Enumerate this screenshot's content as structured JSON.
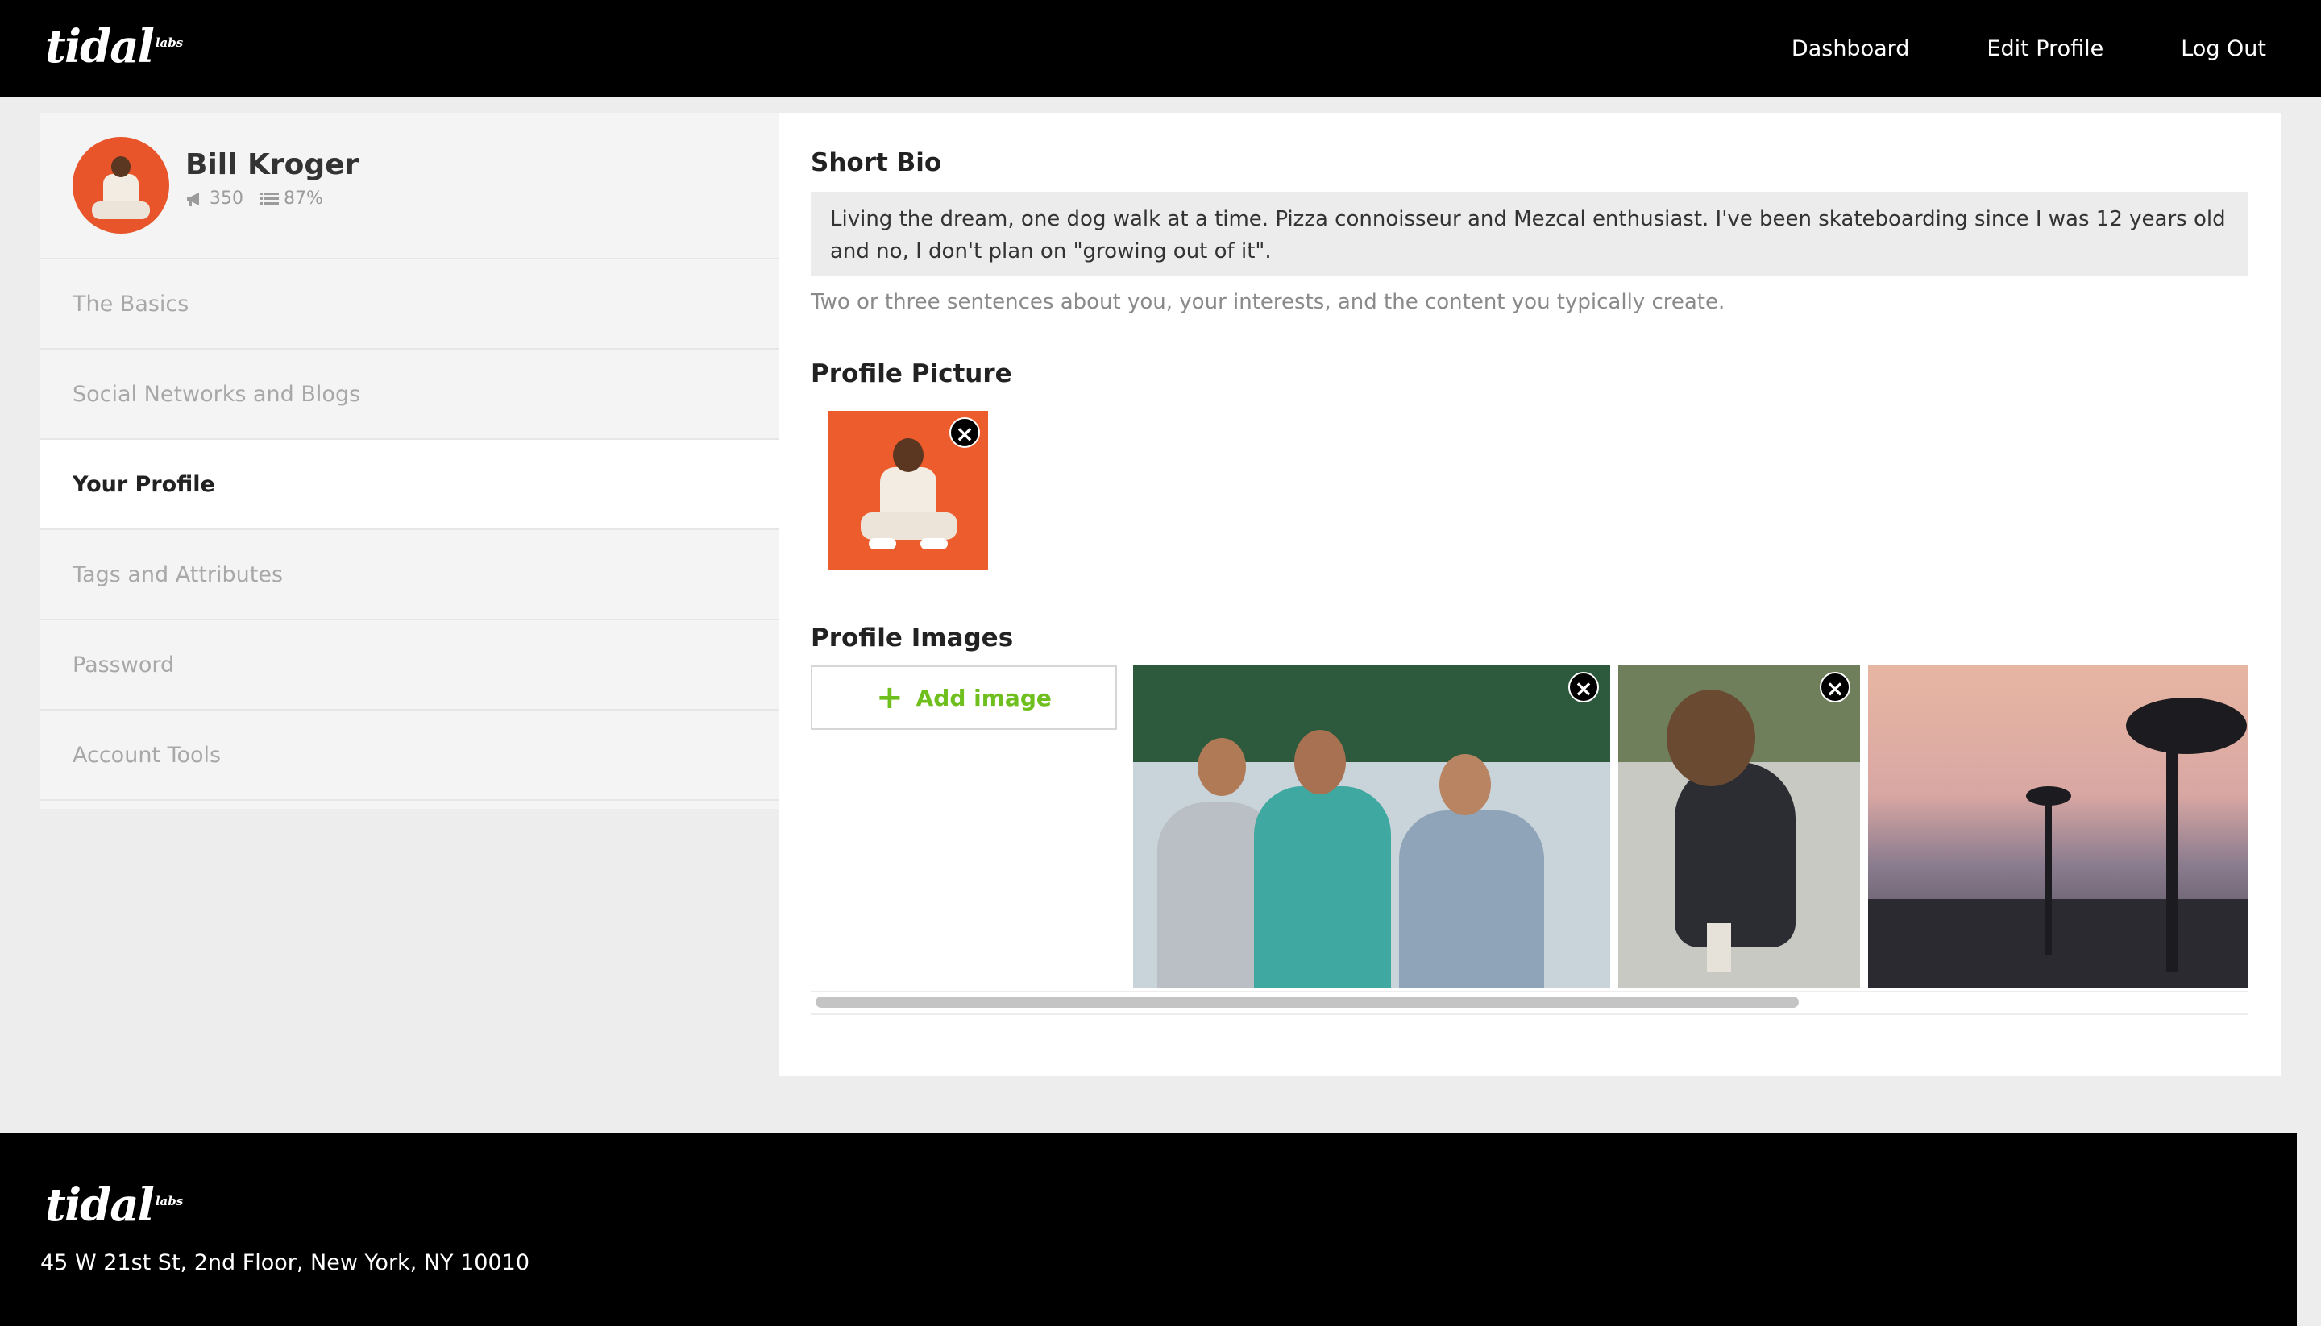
{
  "brand": {
    "name": "tidal",
    "sup": "labs"
  },
  "nav": {
    "dashboard": "Dashboard",
    "edit_profile": "Edit Profile",
    "log_out": "Log Out"
  },
  "user": {
    "name": "Bill Kroger",
    "followers": "350",
    "completion": "87%"
  },
  "sidebar": {
    "items": [
      {
        "label": "The Basics"
      },
      {
        "label": "Social Networks and Blogs"
      },
      {
        "label": "Your Profile"
      },
      {
        "label": "Tags and Attributes"
      },
      {
        "label": "Password"
      },
      {
        "label": "Account Tools"
      }
    ],
    "active": "Your Profile"
  },
  "bio": {
    "title": "Short Bio",
    "value": "Living the dream, one dog walk at a time. Pizza connoisseur and Mezcal enthusiast. I've been skateboarding since I was 12 years old and no, I don't plan on \"growing out of it\".",
    "help": "Two or three sentences about you, your interests, and the content you typically create."
  },
  "picture": {
    "title": "Profile Picture"
  },
  "images": {
    "title": "Profile Images",
    "add_label": "Add image",
    "count": 3
  },
  "icons": {
    "close": "×",
    "plus": "+"
  },
  "colors": {
    "accent": "#6fbf1e",
    "header": "#000000",
    "avatar_bg": "#e9552a"
  },
  "footer": {
    "address": "45 W 21st St, 2nd Floor, New York, NY 10010"
  }
}
